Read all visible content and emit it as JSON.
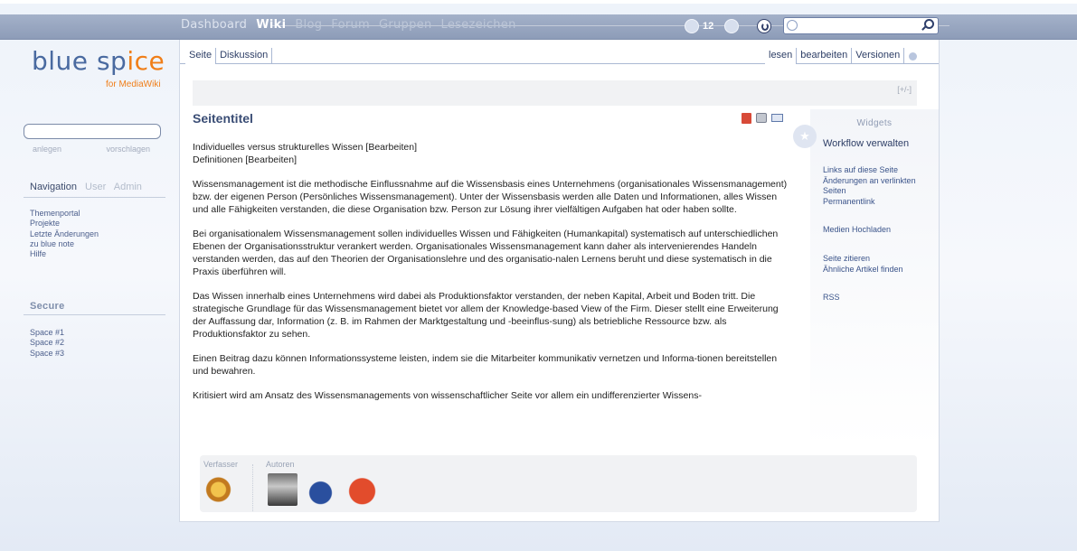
{
  "topnav": {
    "items": [
      "Dashboard",
      "Wiki",
      "Blog",
      "Forum",
      "Gruppen",
      "Lesezeichen"
    ],
    "active": "Wiki",
    "message_count": "12"
  },
  "logo": {
    "name_a": "blue",
    "name_b": "sp",
    "name_c": "ice",
    "sub": "for MediaWiki"
  },
  "sidebar": {
    "search_actions": [
      "anlegen",
      "vorschlagen"
    ],
    "tabs": [
      "Navigation",
      "User",
      "Admin"
    ],
    "nav_links": [
      "Themenportal",
      "Projekte",
      "Letzte Änderungen",
      "zu blue note",
      "Hilfe"
    ],
    "secure_title": "Secure",
    "secure_links": [
      "Space #1",
      "Space #2",
      "Space #3"
    ]
  },
  "content_tabs": {
    "left": [
      "Seite",
      "Diskussion"
    ],
    "right": [
      "lesen",
      "bearbeiten",
      "Versionen"
    ]
  },
  "toolbar": {
    "toggle": "[+/-]"
  },
  "page": {
    "title": "Seitentitel",
    "toc": [
      "Individuelles versus strukturelles Wissen [Bearbeiten]",
      "Definitionen [Bearbeiten]"
    ],
    "paragraphs": [
      "Wissensmanagement ist die methodische Einflussnahme auf die Wissensbasis eines Unternehmens (organisationales Wissensmanagement) bzw. der eigenen Person (Persönliches Wissensmanagement). Unter der Wissensbasis werden alle Daten und Informationen, alles Wissen und alle Fähigkeiten verstanden, die diese Organisation bzw. Person zur Lösung ihrer vielfältigen Aufgaben hat oder haben sollte.",
      "Bei organisationalem Wissensmanagement sollen individuelles Wissen und Fähigkeiten (Humankapital) systematisch auf unterschiedlichen Ebenen der Organisationsstruktur verankert werden. Organisationales Wissensmanagement kann daher als intervenierendes Handeln verstanden werden, das auf den Theorien der Organisationslehre und des organisatio-nalen Lernens beruht und diese systematisch in die Praxis überführen will.",
      "Das Wissen innerhalb eines Unternehmens wird dabei als Produktionsfaktor verstanden, der neben Kapital, Arbeit und Boden tritt. Die strategische Grundlage für das Wissensmanagement bietet vor allem der Knowledge-based View of the Firm. Dieser stellt eine Erweiterung der Auffassung dar, Information (z. B. im Rahmen der Marktgestaltung und -beeinflus-sung) als betriebliche Ressource bzw. als Produktionsfaktor zu sehen.",
      "Einen Beitrag dazu können Informationssysteme leisten, indem sie die Mitarbeiter kommunikativ vernetzen und Informa-tionen bereitstellen und bewahren.",
      "Kritisiert wird am Ansatz des Wissensmanagements von wissenschaftlicher Seite vor allem ein undifferenzierter Wissens-"
    ]
  },
  "widgets": {
    "title": "Widgets",
    "workflow": "Workflow verwalten",
    "links_group1": [
      "Links auf diese Seite",
      "Änderungen an verlinkten Seiten",
      "Permanentlink"
    ],
    "links_group2": [
      "Medien Hochladen"
    ],
    "links_group3": [
      "Seite zitieren",
      "Ähnliche Artikel finden"
    ],
    "links_group4": [
      "RSS"
    ]
  },
  "authors": {
    "creator_label": "Verfasser",
    "authors_label": "Autoren"
  }
}
